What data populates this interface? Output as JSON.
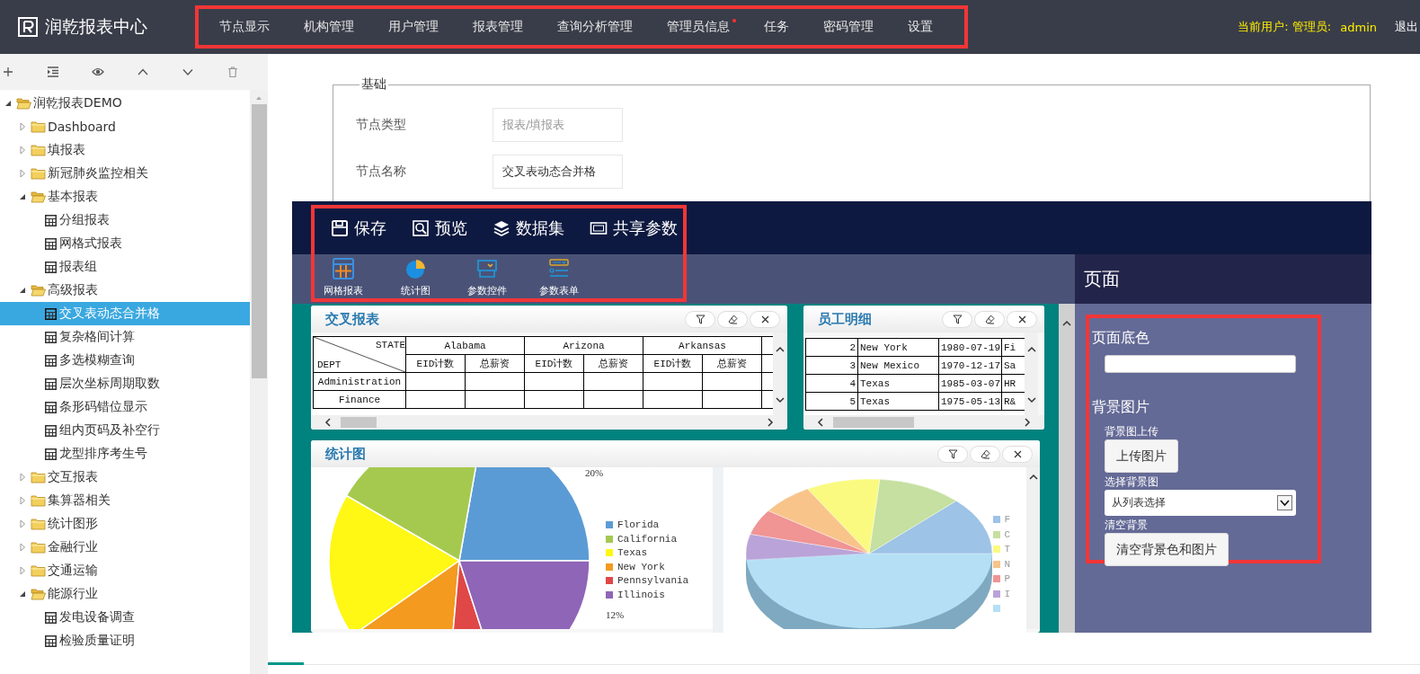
{
  "header": {
    "logo_text": "润乾报表中心",
    "nav": [
      {
        "label": "节点显示",
        "dot": false
      },
      {
        "label": "机构管理",
        "dot": false
      },
      {
        "label": "用户管理",
        "dot": false
      },
      {
        "label": "报表管理",
        "dot": false
      },
      {
        "label": "查询分析管理",
        "dot": false
      },
      {
        "label": "管理员信息",
        "dot": true
      },
      {
        "label": "任务",
        "dot": false
      },
      {
        "label": "密码管理",
        "dot": false
      },
      {
        "label": "设置",
        "dot": false
      }
    ],
    "user_label": "当前用户: 管理员:",
    "user_name": "admin",
    "logout": "退出"
  },
  "sidebar": {
    "tree": [
      {
        "label": "润乾报表DEMO",
        "kind": "folder",
        "expanded": true,
        "selected": false,
        "children": [
          {
            "label": "Dashboard",
            "kind": "folder",
            "expanded": false,
            "selected": false
          },
          {
            "label": "填报表",
            "kind": "folder",
            "expanded": false,
            "selected": false
          },
          {
            "label": "新冠肺炎监控相关",
            "kind": "folder",
            "expanded": false,
            "selected": false
          },
          {
            "label": "基本报表",
            "kind": "folder",
            "expanded": true,
            "selected": false,
            "children": [
              {
                "label": "分组报表",
                "kind": "report",
                "selected": false
              },
              {
                "label": "网格式报表",
                "kind": "report",
                "selected": false
              },
              {
                "label": "报表组",
                "kind": "report",
                "selected": false
              }
            ]
          },
          {
            "label": "高级报表",
            "kind": "folder",
            "expanded": true,
            "selected": false,
            "children": [
              {
                "label": "交叉表动态合并格",
                "kind": "report",
                "selected": true
              },
              {
                "label": "复杂格间计算",
                "kind": "report",
                "selected": false
              },
              {
                "label": "多选模糊查询",
                "kind": "report",
                "selected": false
              },
              {
                "label": "层次坐标周期取数",
                "kind": "report",
                "selected": false
              },
              {
                "label": "条形码错位显示",
                "kind": "report",
                "selected": false
              },
              {
                "label": "组内页码及补空行",
                "kind": "report",
                "selected": false
              },
              {
                "label": "龙型排序考生号",
                "kind": "report",
                "selected": false
              }
            ]
          },
          {
            "label": "交互报表",
            "kind": "folder",
            "expanded": false,
            "selected": false
          },
          {
            "label": "集算器相关",
            "kind": "folder",
            "expanded": false,
            "selected": false
          },
          {
            "label": "统计图形",
            "kind": "folder",
            "expanded": false,
            "selected": false
          },
          {
            "label": "金融行业",
            "kind": "folder",
            "expanded": false,
            "selected": false
          },
          {
            "label": "交通运输",
            "kind": "folder",
            "expanded": false,
            "selected": false
          },
          {
            "label": "能源行业",
            "kind": "folder",
            "expanded": true,
            "selected": false,
            "children": [
              {
                "label": "发电设备调查",
                "kind": "report",
                "selected": false
              },
              {
                "label": "检验质量证明",
                "kind": "report",
                "selected": false
              }
            ]
          }
        ]
      }
    ]
  },
  "form": {
    "legend": "基础",
    "fields": [
      {
        "label": "节点类型",
        "value": "报表/填报表",
        "disabled": true
      },
      {
        "label": "节点名称",
        "value": "交叉表动态合并格",
        "disabled": false
      }
    ]
  },
  "designer": {
    "actions": [
      {
        "label": "保存"
      },
      {
        "label": "预览"
      },
      {
        "label": "数据集"
      },
      {
        "label": "共享参数"
      }
    ],
    "components": [
      {
        "label": "网格报表"
      },
      {
        "label": "统计图"
      },
      {
        "label": "参数控件"
      },
      {
        "label": "参数表单"
      }
    ],
    "crosstab": {
      "title": "交叉报表",
      "corner_top": "STATE",
      "corner_bottom": "DEPT",
      "groups": [
        "Alabama",
        "Arizona",
        "Arkansas"
      ],
      "subheaders": [
        "EID计数",
        "总薪资",
        "EID计数",
        "总薪资",
        "EID计数",
        "总薪资"
      ],
      "rows": [
        "Administration",
        "Finance"
      ]
    },
    "employees": {
      "title": "员工明细",
      "rows": [
        [
          "2",
          "New York",
          "1980-07-19",
          "Fi"
        ],
        [
          "3",
          "New Mexico",
          "1970-12-17",
          "Sa"
        ],
        [
          "4",
          "Texas",
          "1985-03-07",
          "HR"
        ],
        [
          "5",
          "Texas",
          "1975-05-13",
          "R&"
        ]
      ]
    },
    "chart_panel": {
      "title": "统计图",
      "pie_labels": [
        "20%",
        "12%"
      ],
      "legend": [
        {
          "label": "Florida",
          "color": "#5b9bd5"
        },
        {
          "label": "California",
          "color": "#a5c94f"
        },
        {
          "label": "Texas",
          "color": "#fff714"
        },
        {
          "label": "New York",
          "color": "#f39a1f"
        },
        {
          "label": "Pennsylvania",
          "color": "#e04747"
        },
        {
          "label": "Illinois",
          "color": "#8f65b7"
        }
      ],
      "legend_3d": [
        {
          "label": "F",
          "color": "#9dc3e6"
        },
        {
          "label": "C",
          "color": "#c5e0a0"
        },
        {
          "label": "T",
          "color": "#fafa80"
        },
        {
          "label": "N",
          "color": "#f8c48a"
        },
        {
          "label": "P",
          "color": "#f09494"
        },
        {
          "label": "I",
          "color": "#b9a3d8"
        },
        {
          "color": "#b5dff5"
        }
      ]
    },
    "page_panel": {
      "title": "页面",
      "color_label": "页面底色",
      "bg_heading": "背景图片",
      "upload_label": "背景图上传",
      "upload_button": "上传图片",
      "select_label": "选择背景图",
      "select_value": "从列表选择",
      "clear_label": "清空背景",
      "clear_button": "清空背景色和图片"
    }
  }
}
